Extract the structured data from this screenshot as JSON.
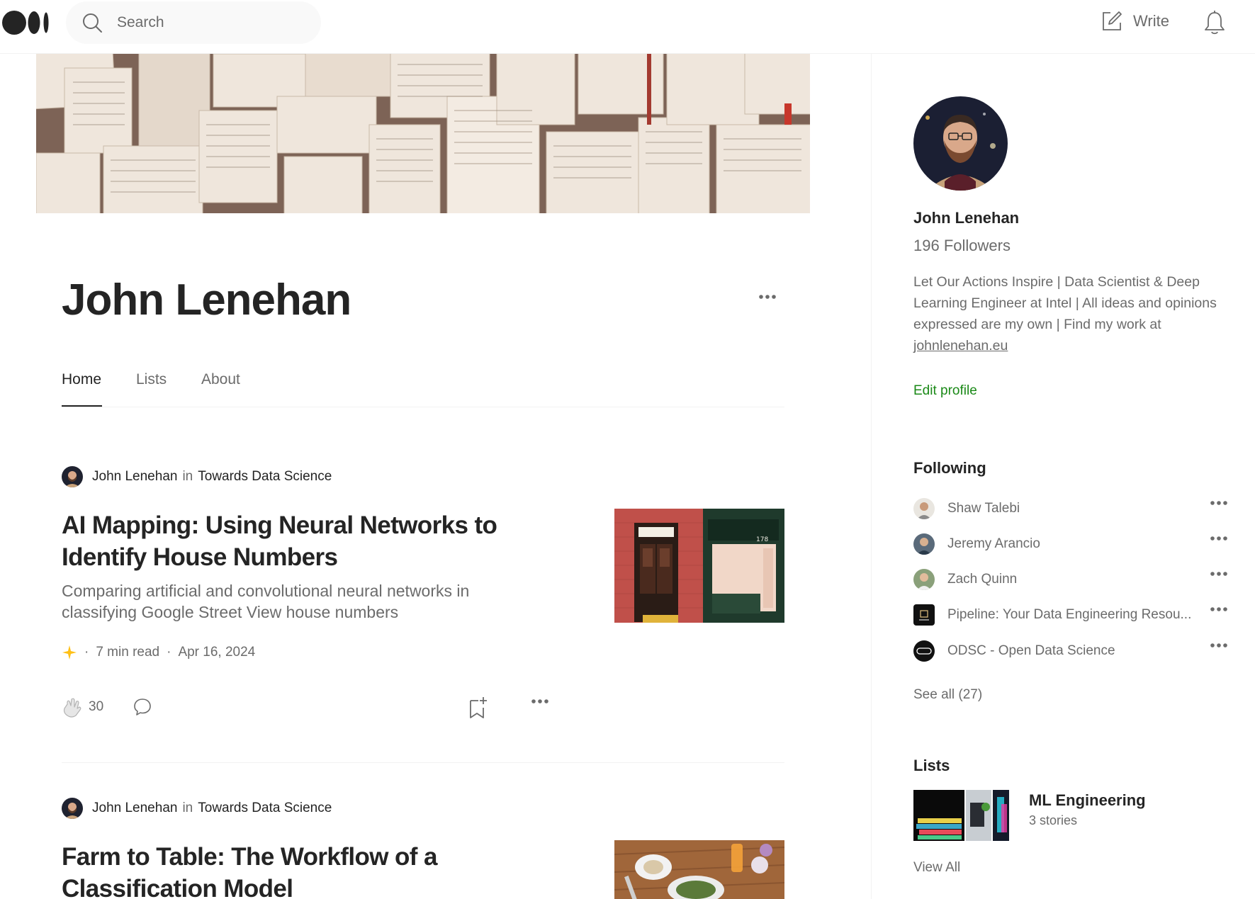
{
  "topbar": {
    "logo": "medium-logo",
    "search_placeholder": "Search",
    "write_label": "Write"
  },
  "profile": {
    "name": "John Lenehan",
    "tabs": [
      {
        "label": "Home",
        "active": true
      },
      {
        "label": "Lists",
        "active": false
      },
      {
        "label": "About",
        "active": false
      }
    ]
  },
  "articles": [
    {
      "author": "John Lenehan",
      "in_label": "in",
      "publication": "Towards Data Science",
      "title": "AI Mapping: Using Neural Networks to Identify House Numbers",
      "subtitle": "Comparing artificial and convolutional neural networks in classifying Google Street View house numbers",
      "read_time": "7 min read",
      "date": "Apr 16, 2024",
      "claps": "30",
      "separator": "·"
    },
    {
      "author": "John Lenehan",
      "in_label": "in",
      "publication": "Towards Data Science",
      "title": "Farm to Table: The Workflow of a Classification Model"
    }
  ],
  "sidebar": {
    "name": "John Lenehan",
    "followers": "196 Followers",
    "bio": "Let Our Actions Inspire | Data Scientist & Deep Learning Engineer at Intel | All ideas and opinions expressed are my own | Find my work at",
    "bio_link": "johnlenehan.eu",
    "edit_profile": "Edit profile",
    "following_heading": "Following",
    "following": [
      {
        "name": "Shaw Talebi"
      },
      {
        "name": "Jeremy Arancio"
      },
      {
        "name": "Zach Quinn"
      },
      {
        "name": "Pipeline: Your Data Engineering Resou..."
      },
      {
        "name": "ODSC - Open Data Science"
      }
    ],
    "see_all": "See all (27)",
    "lists_heading": "Lists",
    "list": {
      "title": "ML Engineering",
      "count": "3 stories"
    },
    "view_all": "View All"
  },
  "colors": {
    "accent_green": "#1a8917",
    "text_primary": "#242424",
    "text_secondary": "#6b6b6b",
    "star": "#ffc017"
  }
}
